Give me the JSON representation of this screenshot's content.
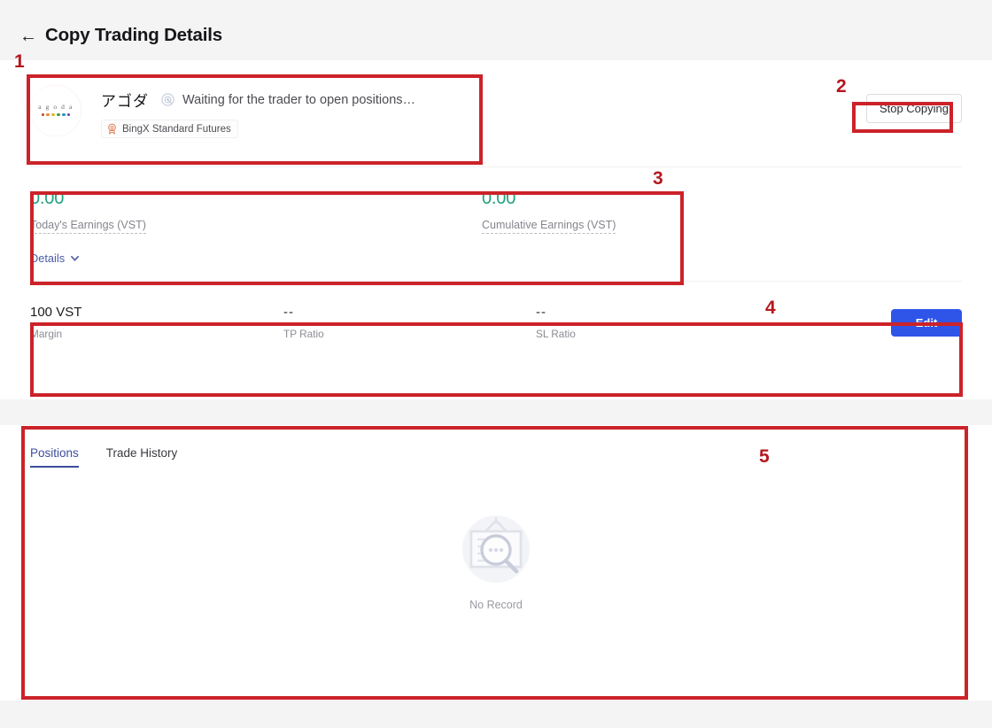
{
  "header": {
    "back_icon": "arrow-left-icon",
    "title": "Copy Trading Details"
  },
  "trader": {
    "avatar": {
      "icon": "agoda-logo-avatar",
      "wordmark": "a g o d a",
      "dot_colors": [
        "#c0452c",
        "#e08f2c",
        "#e0b72c",
        "#3f9e4c",
        "#2a8fc0",
        "#6c3fa0"
      ],
      "ring_gradient": "rainbow"
    },
    "name": "アゴダ",
    "status_icon": "radar-pulse-icon",
    "status": "Waiting for the trader to open positions…",
    "badge_icon": "medal-ribbon-icon",
    "badge_label": "BingX Standard Futures",
    "stop_button": "Stop Copying"
  },
  "earnings": [
    {
      "value": "0.00",
      "label": "Today's Earnings (VST)",
      "color": "#1fa37d"
    },
    {
      "value": "0.00",
      "label": "Cumulative Earnings (VST)",
      "color": "#1fa37d"
    }
  ],
  "details_link": {
    "label": "Details",
    "icon": "chevron-down-icon"
  },
  "settings": {
    "items": [
      {
        "value": "100 VST",
        "label": "Margin"
      },
      {
        "value": "--",
        "label": "TP Ratio"
      },
      {
        "value": "--",
        "label": "SL Ratio"
      }
    ],
    "edit_button": "Edit",
    "edit_button_color": "#2f55e8"
  },
  "tabs": [
    {
      "label": "Positions",
      "active": true
    },
    {
      "label": "Trade History",
      "active": false
    }
  ],
  "empty_state": {
    "icon": "no-record-magnifier-icon",
    "text": "No Record"
  },
  "annotations": [
    {
      "number": "1"
    },
    {
      "number": "2"
    },
    {
      "number": "3"
    },
    {
      "number": "4"
    },
    {
      "number": "5"
    }
  ]
}
